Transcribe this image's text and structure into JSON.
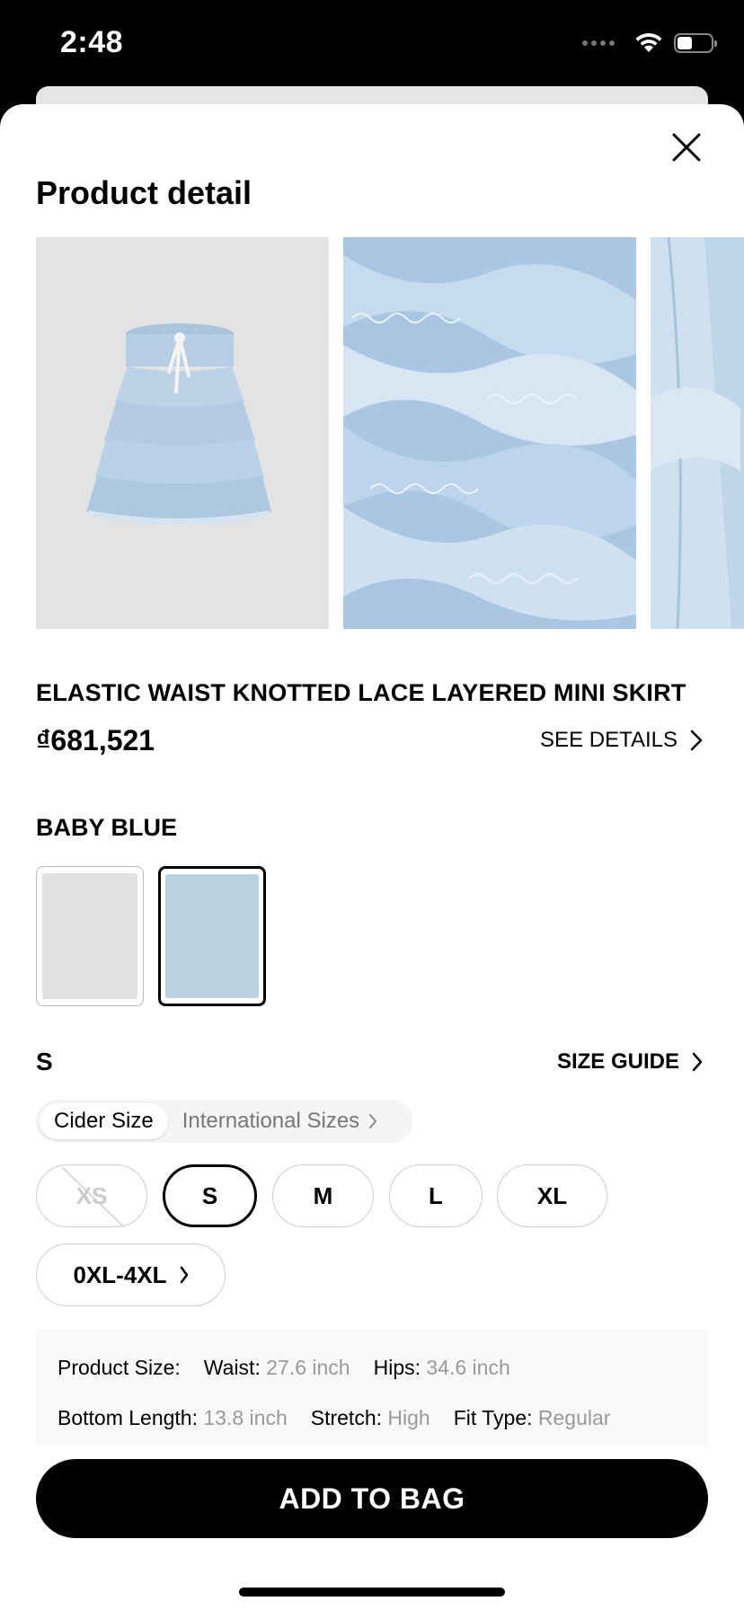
{
  "status_bar": {
    "time": "2:48",
    "battery_level": 0.45
  },
  "sheet": {
    "title": "Product detail",
    "close_icon": "close-icon"
  },
  "gallery": {
    "images": [
      "product-front-image",
      "lace-detail-image",
      "fabric-detail-image"
    ],
    "skirt_color": "#b9d1e6"
  },
  "product": {
    "name": "ELASTIC WAIST KNOTTED LACE LAYERED MINI SKIRT",
    "price": "₫681,521",
    "see_details_label": "SEE DETAILS"
  },
  "color": {
    "selected_label": "BABY BLUE",
    "swatches": [
      {
        "name": "gray-white",
        "hex": "#e2e3e0",
        "selected": false
      },
      {
        "name": "baby-blue",
        "hex": "#bcd2e1",
        "selected": true
      }
    ]
  },
  "size": {
    "selected_label": "S",
    "size_guide_label": "SIZE GUIDE",
    "tabs": [
      "Cider Size",
      "International Sizes"
    ],
    "active_tab": "Cider Size",
    "options": [
      {
        "label": "XS",
        "state": "disabled"
      },
      {
        "label": "S",
        "state": "selected"
      },
      {
        "label": "M",
        "state": "available"
      },
      {
        "label": "L",
        "state": "available"
      },
      {
        "label": "XL",
        "state": "available"
      },
      {
        "label": "0XL-4XL",
        "state": "available"
      }
    ]
  },
  "product_size": {
    "label": "Product Size:",
    "waist_label": "Waist:",
    "waist_value": "27.6 inch",
    "hips_label": "Hips:",
    "hips_value": "34.6 inch",
    "length_label": "Bottom Length:",
    "length_value": "13.8 inch",
    "stretch_label": "Stretch:",
    "stretch_value": "High",
    "fit_label": "Fit Type:",
    "fit_value": "Regular"
  },
  "actions": {
    "add_to_bag": "ADD TO BAG"
  }
}
